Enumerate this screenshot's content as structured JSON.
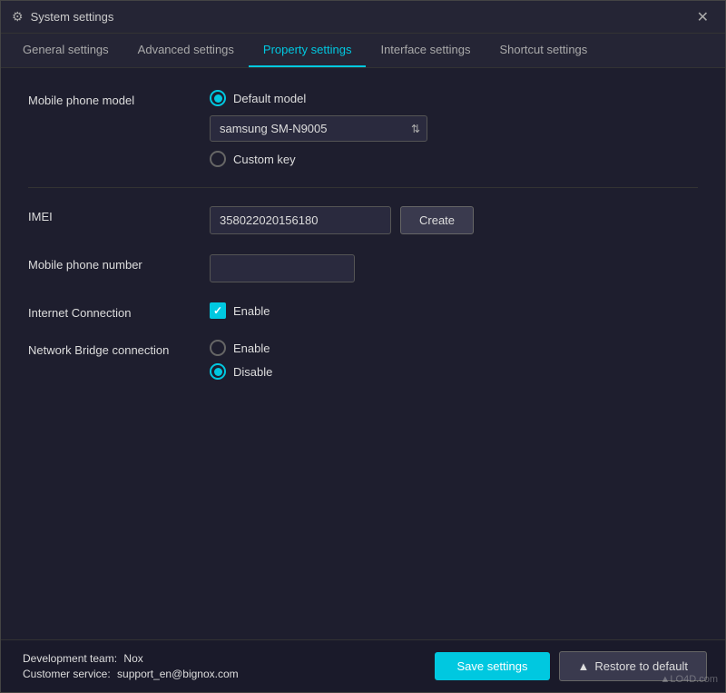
{
  "window": {
    "title": "System settings",
    "close_label": "✕"
  },
  "tabs": [
    {
      "id": "general",
      "label": "General settings",
      "active": false
    },
    {
      "id": "advanced",
      "label": "Advanced settings",
      "active": false
    },
    {
      "id": "property",
      "label": "Property settings",
      "active": true
    },
    {
      "id": "interface",
      "label": "Interface settings",
      "active": false
    },
    {
      "id": "shortcut",
      "label": "Shortcut settings",
      "active": false
    }
  ],
  "fields": {
    "mobile_phone_model_label": "Mobile phone model",
    "default_model_label": "Default model",
    "custom_key_label": "Custom key",
    "model_value": "samsung SM-N9005",
    "imei_label": "IMEI",
    "imei_value": "358022020156180",
    "create_label": "Create",
    "phone_number_label": "Mobile phone number",
    "phone_number_value": "",
    "internet_connection_label": "Internet Connection",
    "internet_enable_label": "Enable",
    "network_bridge_label": "Network Bridge connection",
    "network_bridge_enable_label": "Enable",
    "network_bridge_disable_label": "Disable"
  },
  "footer": {
    "dev_team_label": "Development team:",
    "dev_team_value": "Nox",
    "customer_service_label": "Customer service:",
    "customer_service_value": "support_en@bignox.com",
    "save_label": "Save settings",
    "restore_label": "Restore to default"
  },
  "watermark": "▲LO4D.com"
}
